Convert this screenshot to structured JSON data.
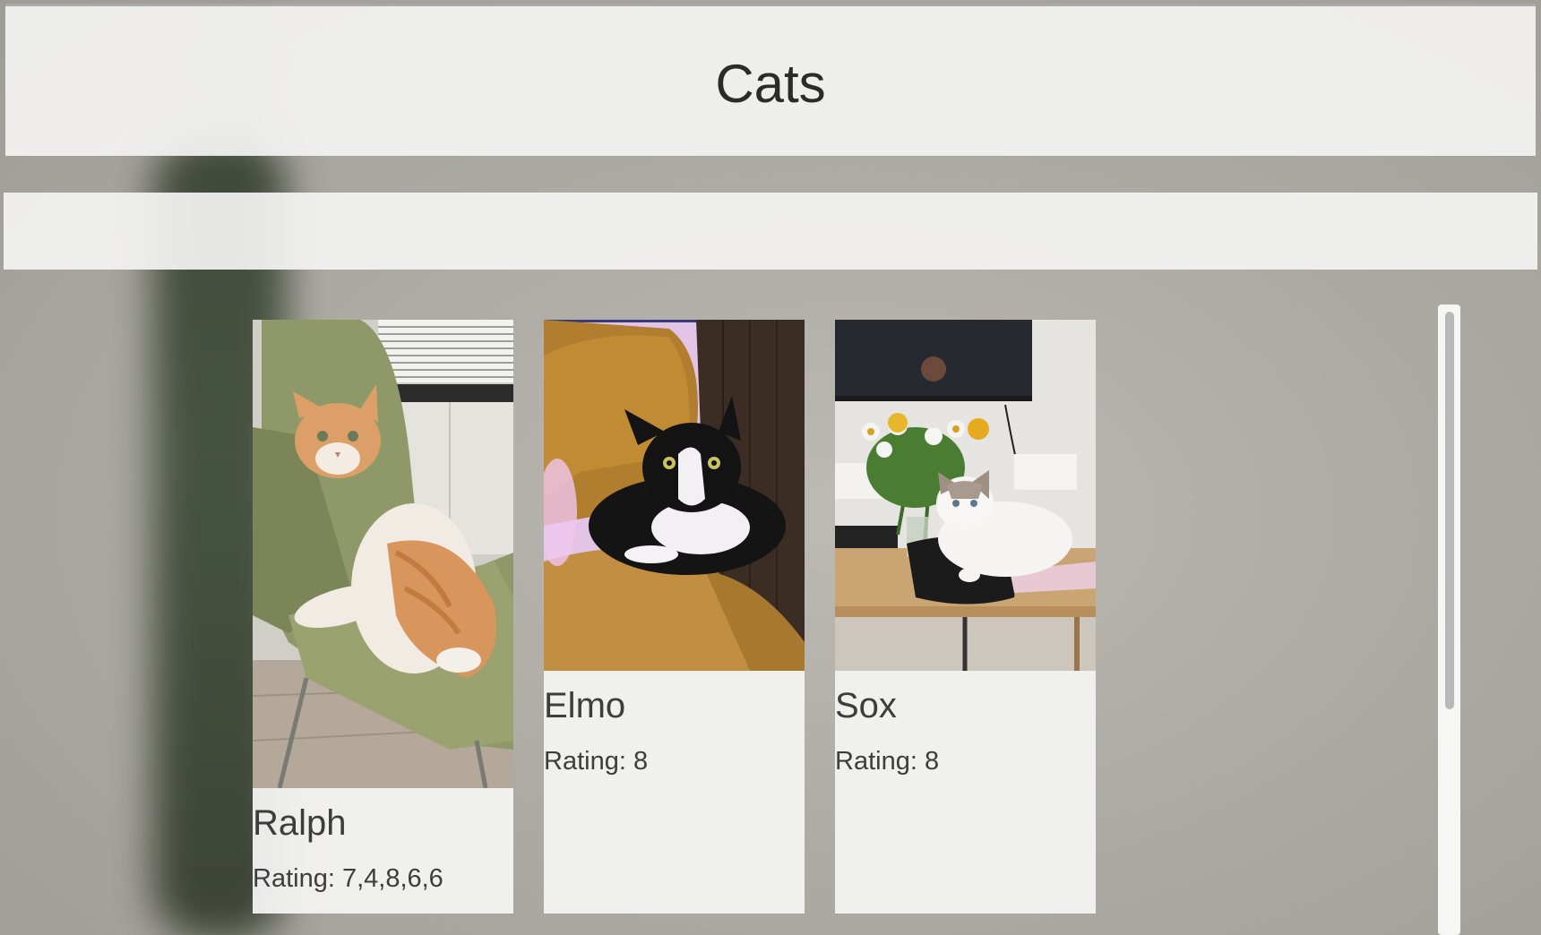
{
  "header": {
    "title": "Cats"
  },
  "cards": [
    {
      "name": "Ralph",
      "rating": "Rating: 7,4,8,6,6",
      "photo_icon": "orange-white-cat-on-chair-photo"
    },
    {
      "name": "Elmo",
      "rating": "Rating: 8",
      "photo_icon": "black-white-cat-on-sofa-photo"
    },
    {
      "name": "Sox",
      "rating": "Rating: 8",
      "photo_icon": "white-cat-on-bag-photo"
    }
  ],
  "colors": {
    "panel": "#f3f3f2",
    "text": "#3d3d3d",
    "background": "#aeaba5",
    "scrollbar_thumb": "#b9b9b9"
  }
}
